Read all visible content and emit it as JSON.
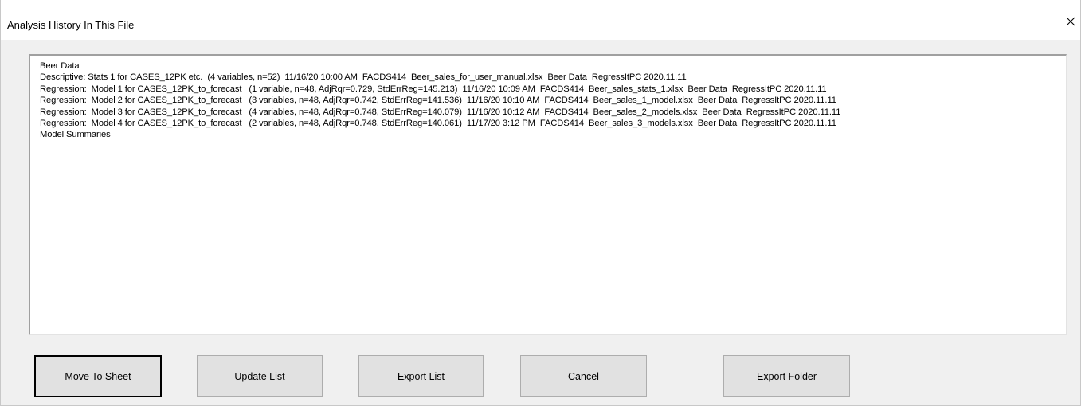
{
  "window": {
    "title": "Analysis History In This File",
    "close_symbol": "✕"
  },
  "history": {
    "items": [
      "Beer Data",
      "Descriptive: Stats 1 for CASES_12PK etc.  (4 variables, n=52)  11/16/20 10:00 AM  FACDS414  Beer_sales_for_user_manual.xlsx  Beer Data  RegressItPC 2020.11.11",
      "Regression:  Model 1 for CASES_12PK_to_forecast   (1 variable, n=48, AdjRqr=0.729, StdErrReg=145.213)  11/16/20 10:09 AM  FACDS414  Beer_sales_stats_1.xlsx  Beer Data  RegressItPC 2020.11.11",
      "Regression:  Model 2 for CASES_12PK_to_forecast   (3 variables, n=48, AdjRqr=0.742, StdErrReg=141.536)  11/16/20 10:10 AM  FACDS414  Beer_sales_1_model.xlsx  Beer Data  RegressItPC 2020.11.11",
      "Regression:  Model 3 for CASES_12PK_to_forecast   (4 variables, n=48, AdjRqr=0.748, StdErrReg=140.079)  11/16/20 10:12 AM  FACDS414  Beer_sales_2_models.xlsx  Beer Data  RegressItPC 2020.11.11",
      "Regression:  Model 4 for CASES_12PK_to_forecast   (2 variables, n=48, AdjRqr=0.748, StdErrReg=140.061)  11/17/20 3:12 PM  FACDS414  Beer_sales_3_models.xlsx  Beer Data  RegressItPC 2020.11.11",
      "Model Summaries"
    ]
  },
  "buttons": {
    "move_to_sheet": "Move To Sheet",
    "update_list": "Update List",
    "export_list": "Export List",
    "cancel": "Cancel",
    "export_folder": "Export Folder"
  },
  "colors": {
    "dialog_background": "#f0f0f0",
    "titlebar_background": "#ffffff",
    "button_face": "#e1e1e1",
    "button_border": "#adadad",
    "default_button_border": "#000000"
  },
  "icons": {
    "close": "close-icon"
  }
}
